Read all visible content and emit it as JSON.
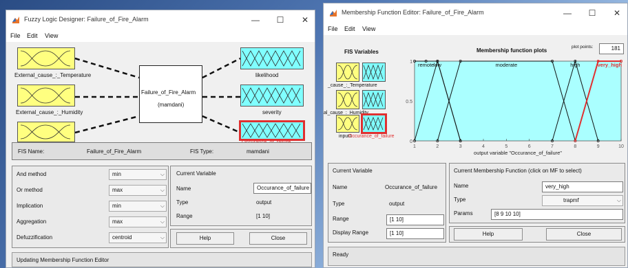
{
  "left": {
    "title": "Fuzzy Logic Designer: Failure_of_Fire_Alarm",
    "menu": [
      "File",
      "Edit",
      "View"
    ],
    "inputs": [
      "External_cause_:_Temperature",
      "External_cause_:_Humidity"
    ],
    "system_box": {
      "name": "Failure_of_Fire_Alarm",
      "type": "(mamdani)"
    },
    "outputs": [
      "likelihood",
      "severity",
      "Occurance_of_failure"
    ],
    "fis_name_label": "FIS Name:",
    "fis_name": "Failure_of_Fire_Alarm",
    "fis_type_label": "FIS Type:",
    "fis_type": "mamdani",
    "methods": [
      {
        "label": "And method",
        "value": "min"
      },
      {
        "label": "Or method",
        "value": "max"
      },
      {
        "label": "Implication",
        "value": "min"
      },
      {
        "label": "Aggregation",
        "value": "max"
      },
      {
        "label": "Defuzzification",
        "value": "centroid"
      }
    ],
    "current_variable": {
      "heading": "Current Variable",
      "name_label": "Name",
      "name": "Occurance_of_failure",
      "type_label": "Type",
      "type": "output",
      "range_label": "Range",
      "range": "[1 10]"
    },
    "help": "Help",
    "close": "Close",
    "status": "Updating Membership Function Editor"
  },
  "right": {
    "title": "Membership Function Editor: Failure_of_Fire_Alarm",
    "menu": [
      "File",
      "Edit",
      "View"
    ],
    "fis_variables_heading": "FIS Variables",
    "var_labels": [
      "_cause_:_Temperature",
      "al_cause_:_Humidity",
      "input1",
      "Occurance_of_failure"
    ],
    "plot_heading": "Membership function plots",
    "plot_points_label": "plot points:",
    "plot_points": "181",
    "xlabel": "output variable \"Occurance_of_failure\"",
    "current_variable": {
      "heading": "Current Variable",
      "name_label": "Name",
      "name": "Occurance_of_failure",
      "type_label": "Type",
      "type": "output",
      "range_label": "Range",
      "range": "[1 10]",
      "display_range_label": "Display Range",
      "display_range": "[1 10]"
    },
    "current_mf": {
      "heading": "Current Membership Function (click on MF to select)",
      "name_label": "Name",
      "name": "very_high",
      "type_label": "Type",
      "type": "trapmf",
      "params_label": "Params",
      "params": "[8 9 10 10]"
    },
    "help": "Help",
    "close": "Close",
    "status": "Ready"
  },
  "window_controls": {
    "minimize": "—",
    "maximize": "☐",
    "close": "✕"
  },
  "colors": {
    "input_mf": "#ffff80",
    "output_mf": "#80ffff",
    "selected": "#e03030",
    "plot_bg": "#aaffff"
  },
  "chart_data": {
    "type": "line",
    "xlabel": "output variable \"Occurance_of_failure\"",
    "xlim": [
      1,
      10
    ],
    "ylim": [
      0,
      1
    ],
    "xticks": [
      1,
      2,
      3,
      4,
      5,
      6,
      7,
      8,
      9,
      10
    ],
    "yticks": [
      0,
      0.5,
      1
    ],
    "series": [
      {
        "name": "remote",
        "x": [
          1,
          1.5,
          2,
          3
        ],
        "y": [
          1,
          1,
          1,
          0
        ]
      },
      {
        "name": "low",
        "x": [
          1,
          2,
          3
        ],
        "y": [
          0,
          1,
          0
        ]
      },
      {
        "name": "moderate",
        "x": [
          2,
          3,
          7,
          8
        ],
        "y": [
          0,
          1,
          1,
          0
        ]
      },
      {
        "name": "high",
        "x": [
          7,
          8,
          9
        ],
        "y": [
          0,
          1,
          0
        ]
      },
      {
        "name": "very_high",
        "x": [
          8,
          9,
          10,
          10
        ],
        "y": [
          0,
          1,
          1,
          1
        ],
        "selected": true
      }
    ]
  }
}
